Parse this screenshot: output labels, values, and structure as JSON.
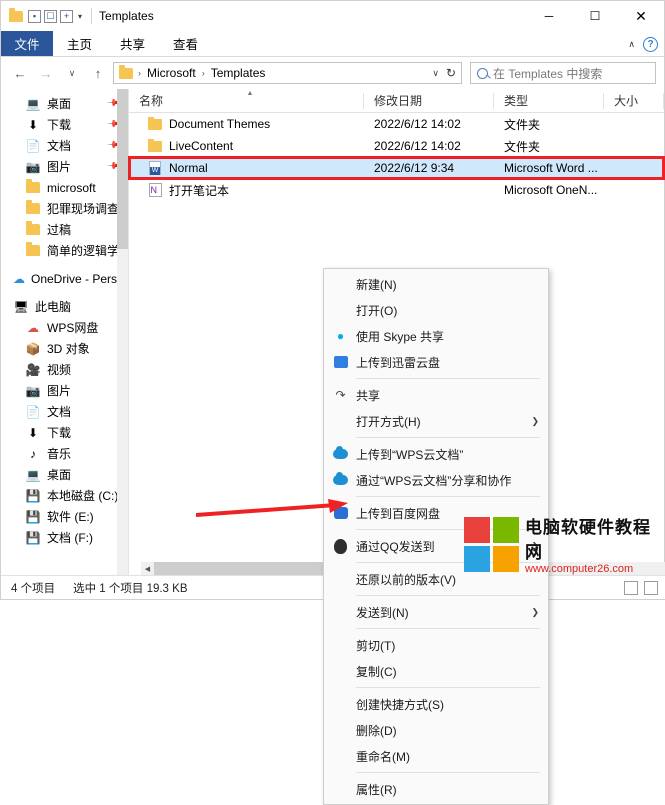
{
  "window": {
    "title": "Templates",
    "caption": {
      "minimize": "─",
      "maximize": "☐",
      "close": "✕"
    },
    "qat": {
      "folder_icon": "folder-icon",
      "save_icon": "save-icon",
      "undo_icon": "undo-icon",
      "dropdown": "▾"
    }
  },
  "ribbon": {
    "tabs": [
      {
        "label": "文件",
        "active": true
      },
      {
        "label": "主页",
        "active": false
      },
      {
        "label": "共享",
        "active": false
      },
      {
        "label": "查看",
        "active": false
      }
    ],
    "collapse": "∧",
    "help": "?"
  },
  "address": {
    "back": "←",
    "forward": "→",
    "recent": "∨",
    "up": "↑",
    "crumbs": [
      "Microsoft",
      "Templates"
    ],
    "separator": "›",
    "dropdown": "∨",
    "refresh": "↻"
  },
  "search": {
    "placeholder": "在 Templates 中搜索",
    "icon": "search-icon"
  },
  "nav": {
    "items": [
      {
        "label": "桌面",
        "icon": "desktop-icon",
        "level": 2,
        "pinned": true
      },
      {
        "label": "下载",
        "icon": "download-icon",
        "level": 2,
        "pinned": true
      },
      {
        "label": "文档",
        "icon": "document-icon",
        "level": 2,
        "pinned": true
      },
      {
        "label": "图片",
        "icon": "picture-icon",
        "level": 2,
        "pinned": true
      },
      {
        "label": "microsoft",
        "icon": "folder-icon",
        "level": 2,
        "pinned": false
      },
      {
        "label": "犯罪现场调查",
        "icon": "folder-icon",
        "level": 2,
        "pinned": false
      },
      {
        "label": "过稿",
        "icon": "folder-icon",
        "level": 2,
        "pinned": false
      },
      {
        "label": "简单的逻辑学",
        "icon": "folder-icon",
        "level": 2,
        "pinned": false
      },
      {
        "label": "OneDrive - Personal",
        "icon": "onedrive-icon",
        "level": 1,
        "pinned": false
      },
      {
        "label": "此电脑",
        "icon": "pc-icon",
        "level": 1,
        "pinned": false
      },
      {
        "label": "WPS网盘",
        "icon": "wps-icon",
        "level": 2,
        "pinned": false
      },
      {
        "label": "3D 对象",
        "icon": "3d-icon",
        "level": 2,
        "pinned": false
      },
      {
        "label": "视频",
        "icon": "video-icon",
        "level": 2,
        "pinned": false
      },
      {
        "label": "图片",
        "icon": "picture-icon",
        "level": 2,
        "pinned": false
      },
      {
        "label": "文档",
        "icon": "document-icon",
        "level": 2,
        "pinned": false
      },
      {
        "label": "下载",
        "icon": "download-icon",
        "level": 2,
        "pinned": false
      },
      {
        "label": "音乐",
        "icon": "music-icon",
        "level": 2,
        "pinned": false
      },
      {
        "label": "桌面",
        "icon": "desktop-icon",
        "level": 2,
        "pinned": false
      },
      {
        "label": "本地磁盘 (C:)",
        "icon": "drive-icon",
        "level": 2,
        "pinned": false
      },
      {
        "label": "软件 (E:)",
        "icon": "drive-icon",
        "level": 2,
        "pinned": false
      },
      {
        "label": "文档 (F:)",
        "icon": "drive-icon",
        "level": 2,
        "pinned": false
      }
    ]
  },
  "columns": [
    {
      "key": "name",
      "label": "名称"
    },
    {
      "key": "date",
      "label": "修改日期"
    },
    {
      "key": "type",
      "label": "类型"
    },
    {
      "key": "size",
      "label": "大小"
    }
  ],
  "files": [
    {
      "name": "Document Themes",
      "date": "2022/6/12 14:02",
      "type": "文件夹",
      "size": "",
      "icon": "folder-icon",
      "selected": false
    },
    {
      "name": "LiveContent",
      "date": "2022/6/12 14:02",
      "type": "文件夹",
      "size": "",
      "icon": "folder-icon",
      "selected": false
    },
    {
      "name": "Normal",
      "date": "2022/6/12 9:34",
      "type": "Microsoft Word ...",
      "size": "",
      "icon": "word-doc-icon",
      "selected": true
    },
    {
      "name": "打开笔记本",
      "date": "",
      "type": "Microsoft OneN...",
      "size": "",
      "icon": "onenote-icon",
      "selected": false
    }
  ],
  "context_menu": {
    "items": [
      {
        "label": "新建(N)",
        "icon": "",
        "submenu": false,
        "sep_after": false
      },
      {
        "label": "打开(O)",
        "icon": "",
        "submenu": false,
        "sep_after": false
      },
      {
        "label": "使用 Skype 共享",
        "icon": "skype-icon",
        "submenu": false,
        "sep_after": false
      },
      {
        "label": "上传到迅雷云盘",
        "icon": "thunder-icon",
        "submenu": false,
        "sep_after": true
      },
      {
        "label": "共享",
        "icon": "share-icon",
        "submenu": false,
        "sep_after": false
      },
      {
        "label": "打开方式(H)",
        "icon": "",
        "submenu": true,
        "sep_after": true
      },
      {
        "label": "上传到“WPS云文档”",
        "icon": "cloud-icon",
        "submenu": false,
        "sep_after": false
      },
      {
        "label": "通过“WPS云文档”分享和协作",
        "icon": "cloud-icon",
        "submenu": false,
        "sep_after": true
      },
      {
        "label": "上传到百度网盘",
        "icon": "baidu-icon",
        "submenu": false,
        "sep_after": true
      },
      {
        "label": "通过QQ发送到",
        "icon": "qq-icon",
        "submenu": true,
        "sep_after": true
      },
      {
        "label": "还原以前的版本(V)",
        "icon": "",
        "submenu": false,
        "sep_after": true
      },
      {
        "label": "发送到(N)",
        "icon": "",
        "submenu": true,
        "sep_after": true
      },
      {
        "label": "剪切(T)",
        "icon": "",
        "submenu": false,
        "sep_after": false
      },
      {
        "label": "复制(C)",
        "icon": "",
        "submenu": false,
        "sep_after": true
      },
      {
        "label": "创建快捷方式(S)",
        "icon": "",
        "submenu": false,
        "sep_after": false
      },
      {
        "label": "删除(D)",
        "icon": "",
        "submenu": false,
        "sep_after": false
      },
      {
        "label": "重命名(M)",
        "icon": "",
        "submenu": false,
        "sep_after": true
      },
      {
        "label": "属性(R)",
        "icon": "",
        "submenu": false,
        "sep_after": false
      }
    ]
  },
  "status": {
    "count": "4 个项目",
    "selection": "选中 1 个项目  19.3 KB"
  },
  "watermark": {
    "title": "电脑软硬件教程网",
    "url": "www.computer26.com"
  },
  "colors": {
    "accent": "#2b579a",
    "selection": "#cfe8fc",
    "annotation": "#ee2222",
    "folder": "#f6c453"
  }
}
